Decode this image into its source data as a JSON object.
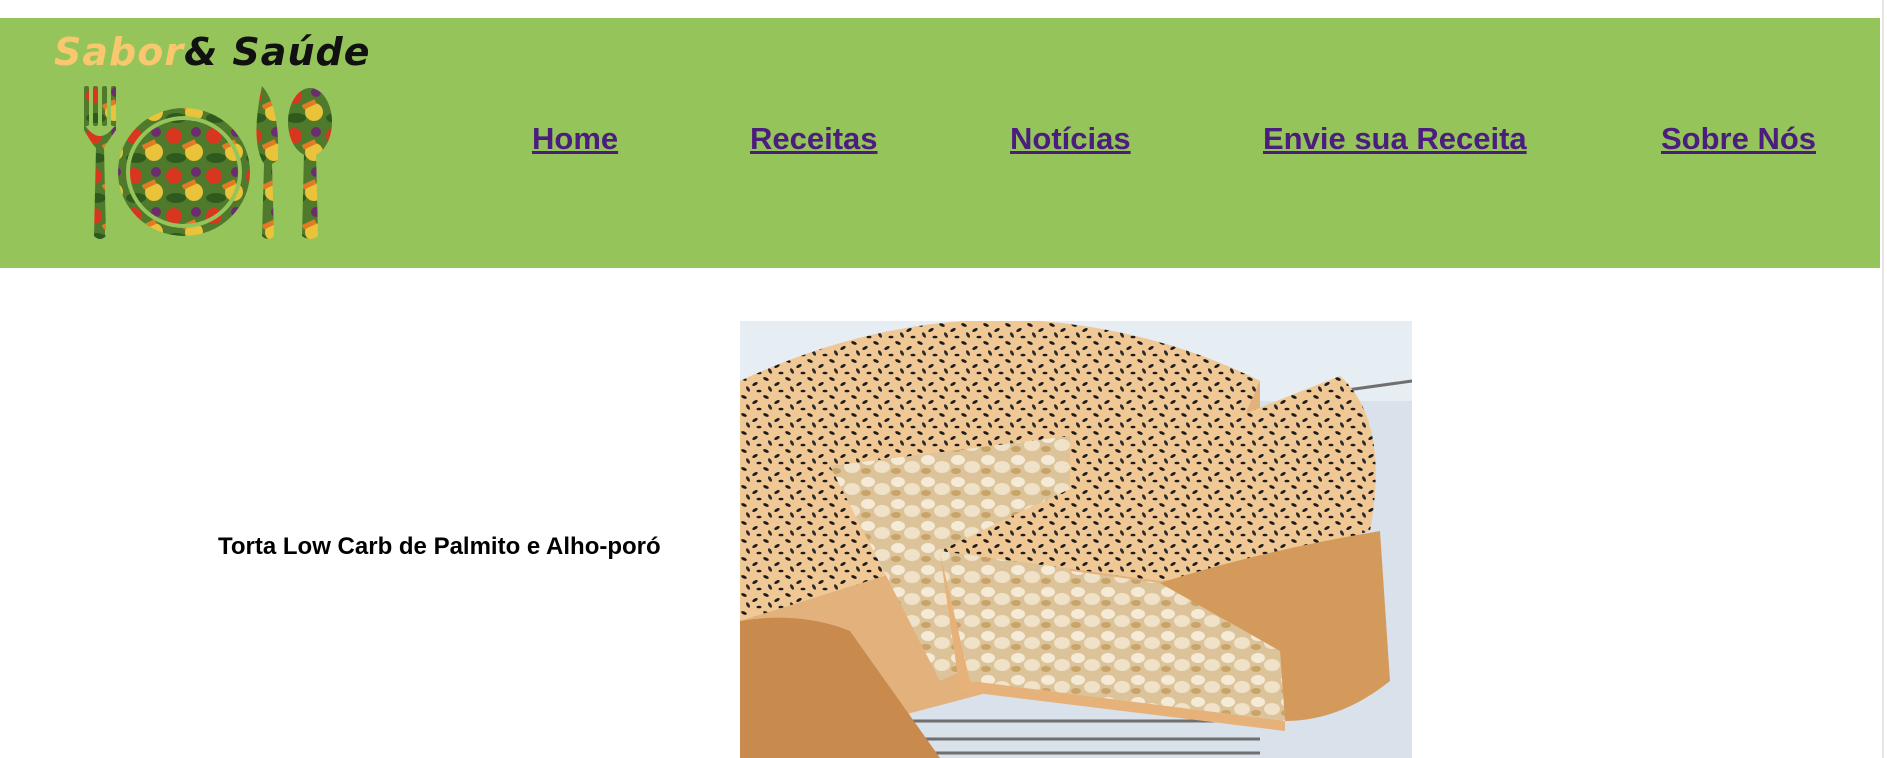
{
  "brand": {
    "word1": "Sabor",
    "word2": "& Saúde",
    "logo_icon": "fork-plate-knife-spoon-vegetables-logo"
  },
  "nav": {
    "home": "Home",
    "recipes": "Receitas",
    "news": "Notícias",
    "submit_recipe": "Envie sua Receita",
    "about": "Sobre Nós"
  },
  "recipe": {
    "title": "Torta Low Carb de Palmito e Alho-poró",
    "image": "leek-and-palm-heart-pie-photo"
  },
  "colors": {
    "header_bg": "#94c45a",
    "link": "#4b1e7e",
    "brand_accent": "#f9c86e"
  }
}
